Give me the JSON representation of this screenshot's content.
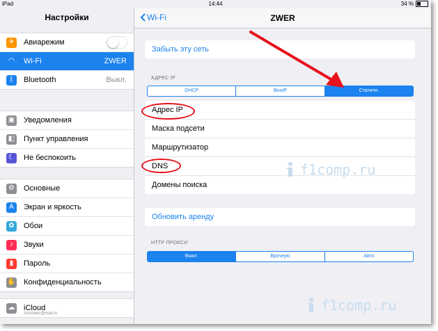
{
  "status_bar": {
    "device": "iPad",
    "time": "14:44",
    "battery": "34 %",
    "battery_level": 0.34
  },
  "sidebar": {
    "title": "Настройки",
    "groups": [
      [
        {
          "label": "Авиарежим",
          "icon": "airplane-icon",
          "color": "#ff9500",
          "toggle": false
        },
        {
          "label": "Wi-Fi",
          "value": "ZWER",
          "icon": "wifi-icon",
          "color": "#1b82ee",
          "selected": true
        },
        {
          "label": "Bluetooth",
          "value": "Выкл.",
          "icon": "bluetooth-icon",
          "color": "#1b82ee"
        }
      ],
      [
        {
          "label": "Уведомления",
          "icon": "notifications-icon",
          "color": "#8e8e93"
        },
        {
          "label": "Пункт управления",
          "icon": "control-center-icon",
          "color": "#8e8e93"
        },
        {
          "label": "Не беспокоить",
          "icon": "moon-icon",
          "color": "#5856d6"
        }
      ],
      [
        {
          "label": "Основные",
          "icon": "gear-icon",
          "color": "#8e8e93"
        },
        {
          "label": "Экран и яркость",
          "icon": "brightness-icon",
          "color": "#1b82ee"
        },
        {
          "label": "Обои",
          "icon": "wallpaper-icon",
          "color": "#34aadc"
        },
        {
          "label": "Звуки",
          "icon": "speaker-icon",
          "color": "#ff2d55"
        },
        {
          "label": "Пароль",
          "icon": "lock-icon",
          "color": "#ff3b30"
        },
        {
          "label": "Конфиденциальность",
          "icon": "hand-icon",
          "color": "#8e8e93"
        }
      ],
      [
        {
          "label": "iCloud",
          "sub": "zerozwer@mail.ru",
          "icon": "cloud-icon",
          "color": "#8e8e93"
        }
      ]
    ]
  },
  "nav": {
    "back_label": "Wi-Fi",
    "title": "ZWER"
  },
  "main": {
    "forget_label": "Забыть эту сеть",
    "ip_header": "АДРЕС IP",
    "ip_segments": [
      "DHCP",
      "BootP",
      "Статичн."
    ],
    "ip_selected": 2,
    "ip_rows": [
      "Адрес IP",
      "Маска подсети",
      "Маршрутизатор",
      "DNS",
      "Домены поиска"
    ],
    "renew_label": "Обновить аренду",
    "proxy_header": "HTTP ПРОКСИ",
    "proxy_segments": [
      "Выкл.",
      "Вручную",
      "Авто"
    ],
    "proxy_selected": 0
  },
  "watermark": "f1comp.ru",
  "colors": {
    "accent": "#1b82ee",
    "annotation": "#e8101a"
  }
}
